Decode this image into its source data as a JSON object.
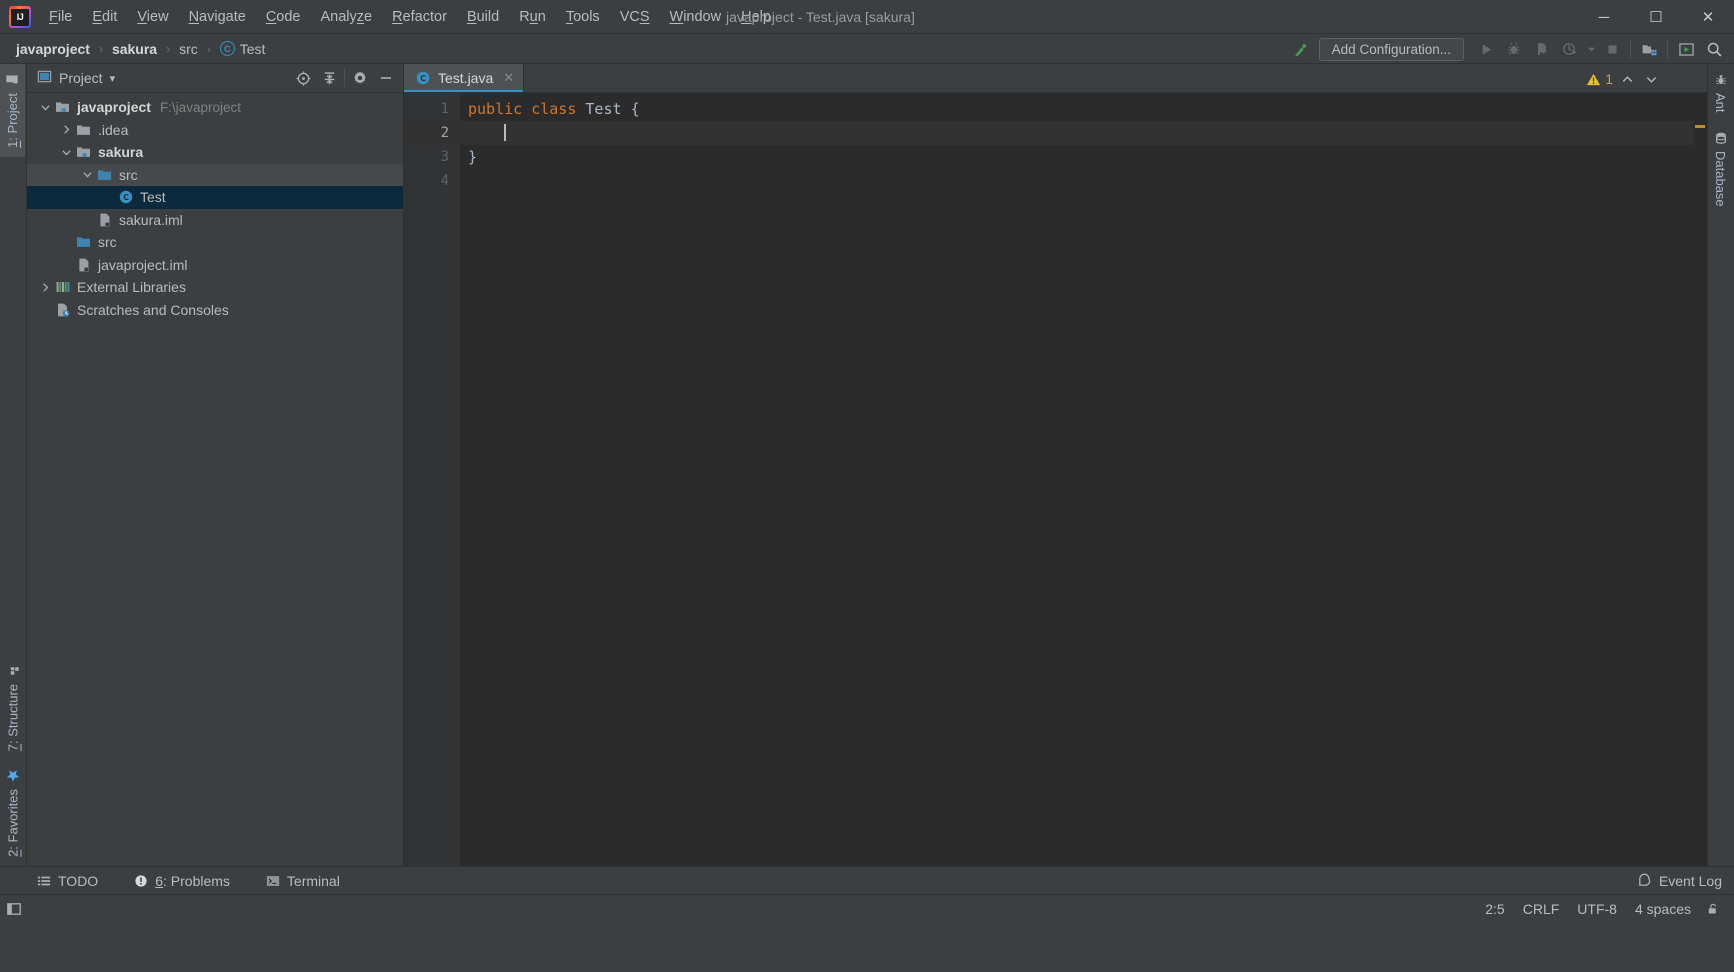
{
  "window": {
    "title": "javaproject - Test.java [sakura]",
    "minimize": "─",
    "maximize": "☐",
    "close": "✕"
  },
  "menubar": {
    "items": [
      {
        "label": "File",
        "mnemonic": "F"
      },
      {
        "label": "Edit",
        "mnemonic": "E"
      },
      {
        "label": "View",
        "mnemonic": "V"
      },
      {
        "label": "Navigate",
        "mnemonic": "N"
      },
      {
        "label": "Code",
        "mnemonic": "C"
      },
      {
        "label": "Analyze",
        "mnemonic": "z"
      },
      {
        "label": "Refactor",
        "mnemonic": "R"
      },
      {
        "label": "Build",
        "mnemonic": "B"
      },
      {
        "label": "Run",
        "mnemonic": "u"
      },
      {
        "label": "Tools",
        "mnemonic": "T"
      },
      {
        "label": "VCS",
        "mnemonic": "S"
      },
      {
        "label": "Window",
        "mnemonic": "W"
      },
      {
        "label": "Help",
        "mnemonic": "H"
      }
    ]
  },
  "breadcrumb": {
    "items": [
      {
        "label": "javaproject",
        "bold": true,
        "icon": null
      },
      {
        "label": "sakura",
        "bold": true,
        "icon": null
      },
      {
        "label": "src",
        "bold": false,
        "icon": null
      },
      {
        "label": "Test",
        "bold": false,
        "icon": "class-icon"
      }
    ],
    "separator": "›"
  },
  "toolbar": {
    "build_label": "build-hammer-icon",
    "add_configuration": "Add Configuration...",
    "run_label": "run-icon",
    "debug_label": "debug-icon",
    "run_coverage_label": "run-with-coverage-icon",
    "profile_label": "profile-icon",
    "dropdown_label": "chevron-down-icon",
    "stop_label": "stop-icon",
    "project_structure_label": "project-structure-icon",
    "updates_label": "updates-icon",
    "search_label": "search-everywhere-icon"
  },
  "left_stripe": {
    "top": [
      {
        "label": "1: Project",
        "mnemonic": "1",
        "icon": "project-folder-icon",
        "active": true
      }
    ],
    "bottom": [
      {
        "label": "7: Structure",
        "mnemonic": "7",
        "icon": "structure-icon",
        "active": false
      },
      {
        "label": "2: Favorites",
        "mnemonic": "2",
        "icon": "favorites-star-icon",
        "active": false
      }
    ]
  },
  "right_stripe": {
    "items": [
      {
        "label": "Ant",
        "icon": "ant-icon"
      },
      {
        "label": "Database",
        "icon": "database-icon"
      }
    ]
  },
  "project_panel": {
    "title": "Project",
    "dropdown": "▾",
    "tools": [
      {
        "name": "locate-icon",
        "glyph": "crosshair"
      },
      {
        "name": "collapse-all-icon",
        "glyph": "collapse"
      },
      {
        "name": "settings-gear-icon",
        "glyph": "gear"
      },
      {
        "name": "hide-panel-icon",
        "glyph": "minus"
      }
    ],
    "tree": [
      {
        "label": "javaproject",
        "path": "F:\\javaproject",
        "indent": 0,
        "arrow": "open",
        "icon": "module-folder-icon",
        "bold": true,
        "state": "normal"
      },
      {
        "label": ".idea",
        "path": "",
        "indent": 1,
        "arrow": "closed",
        "icon": "folder-icon",
        "bold": false,
        "state": "normal"
      },
      {
        "label": "sakura",
        "path": "",
        "indent": 1,
        "arrow": "open",
        "icon": "module-folder-icon",
        "bold": true,
        "state": "normal"
      },
      {
        "label": "src",
        "path": "",
        "indent": 2,
        "arrow": "open",
        "icon": "source-folder-icon",
        "bold": false,
        "state": "hovered"
      },
      {
        "label": "Test",
        "path": "",
        "indent": 3,
        "arrow": "none",
        "icon": "java-class-icon",
        "bold": false,
        "state": "selected"
      },
      {
        "label": "sakura.iml",
        "path": "",
        "indent": 2,
        "arrow": "none",
        "icon": "iml-file-icon",
        "bold": false,
        "state": "normal"
      },
      {
        "label": "src",
        "path": "",
        "indent": 1,
        "arrow": "none",
        "icon": "source-folder-icon",
        "bold": false,
        "state": "normal"
      },
      {
        "label": "javaproject.iml",
        "path": "",
        "indent": 1,
        "arrow": "none",
        "icon": "iml-file-icon",
        "bold": false,
        "state": "normal"
      },
      {
        "label": "External Libraries",
        "path": "",
        "indent": 0,
        "arrow": "closed",
        "icon": "libraries-icon",
        "bold": false,
        "state": "normal"
      },
      {
        "label": "Scratches and Consoles",
        "path": "",
        "indent": 0,
        "arrow": "none",
        "icon": "scratches-icon",
        "bold": false,
        "state": "normal"
      }
    ]
  },
  "editor": {
    "tabs": [
      {
        "label": "Test.java",
        "icon": "java-class-icon",
        "active": true,
        "close": "✕"
      }
    ],
    "line_numbers": [
      "1",
      "2",
      "3",
      "4"
    ],
    "lines": [
      {
        "tokens": [
          {
            "text": "public",
            "type": "kw"
          },
          {
            "text": " ",
            "type": "plain"
          },
          {
            "text": "class",
            "type": "kw"
          },
          {
            "text": " ",
            "type": "plain"
          },
          {
            "text": "Test",
            "type": "cls"
          },
          {
            "text": " ",
            "type": "plain"
          },
          {
            "text": "{",
            "type": "brace"
          }
        ],
        "current": false
      },
      {
        "tokens": [
          {
            "text": "    ",
            "type": "plain"
          }
        ],
        "current": true,
        "caret": true
      },
      {
        "tokens": [
          {
            "text": "}",
            "type": "brace"
          }
        ],
        "current": false
      },
      {
        "tokens": [],
        "current": false
      }
    ],
    "inspection": {
      "warning_count": "1",
      "warning_icon": "warning-triangle-icon",
      "prev_label": "⌃",
      "next_label": "⌄"
    }
  },
  "bottom_tools": {
    "items": [
      {
        "label": "TODO",
        "mnemonic": "",
        "icon": "todo-list-icon"
      },
      {
        "label": "6: Problems",
        "mnemonic": "6",
        "icon": "problems-icon"
      },
      {
        "label": "Terminal",
        "mnemonic": "",
        "icon": "terminal-icon"
      }
    ],
    "event_log": {
      "label": "Event Log",
      "icon": "event-log-icon"
    }
  },
  "statusbar": {
    "toggle_icon": "toggle-toolwindows-icon",
    "items": [
      {
        "label": "2:5",
        "name": "caret-position"
      },
      {
        "label": "CRLF",
        "name": "line-separator"
      },
      {
        "label": "UTF-8",
        "name": "file-encoding"
      },
      {
        "label": "4 spaces",
        "name": "indent-setting"
      }
    ],
    "lock_icon": "unlocked-padlock-icon"
  },
  "colors": {
    "chrome": "#3c3f41",
    "editor_bg": "#2b2b2b",
    "gutter_bg": "#313335",
    "accent_blue": "#3592c4",
    "selection": "#0d293e",
    "keyword_orange": "#cc7832",
    "text": "#bbbbbb",
    "warning_yellow": "#bb9123"
  }
}
